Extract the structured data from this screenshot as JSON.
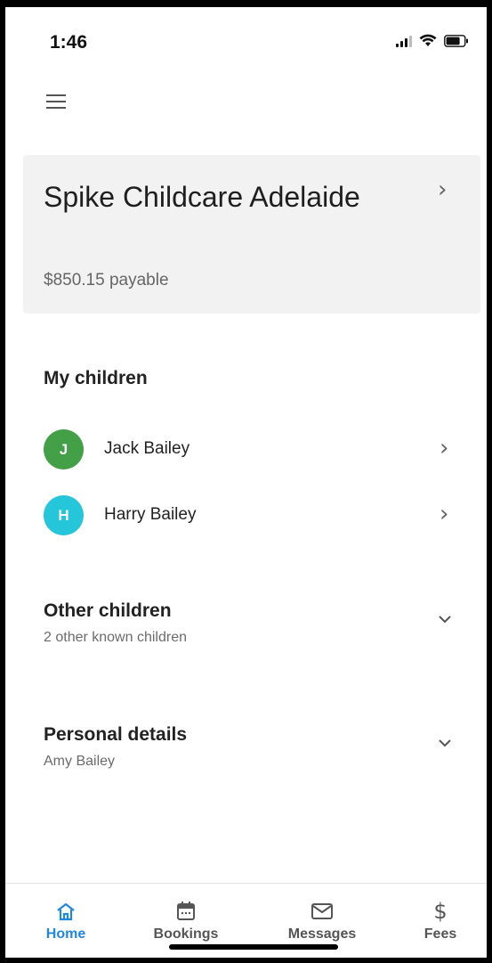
{
  "status_bar": {
    "time": "1:46"
  },
  "centre": {
    "name": "Spike Childcare Adelaide",
    "payable": "$850.15 payable"
  },
  "my_children": {
    "title": "My children",
    "items": [
      {
        "initial": "J",
        "name": "Jack Bailey",
        "color": "#43a047"
      },
      {
        "initial": "H",
        "name": "Harry Bailey",
        "color": "#26c6da"
      }
    ]
  },
  "other_children": {
    "title": "Other children",
    "subtitle": "2 other known children"
  },
  "personal_details": {
    "title": "Personal details",
    "subtitle": "Amy Bailey"
  },
  "bottom_nav": [
    {
      "label": "Home",
      "icon": "home-icon",
      "active": true
    },
    {
      "label": "Bookings",
      "icon": "calendar-icon",
      "active": false
    },
    {
      "label": "Messages",
      "icon": "mail-icon",
      "active": false
    },
    {
      "label": "Fees",
      "icon": "dollar-icon",
      "active": false
    }
  ],
  "colors": {
    "accent": "#1e88e5",
    "card_bg": "#f2f2f2"
  }
}
